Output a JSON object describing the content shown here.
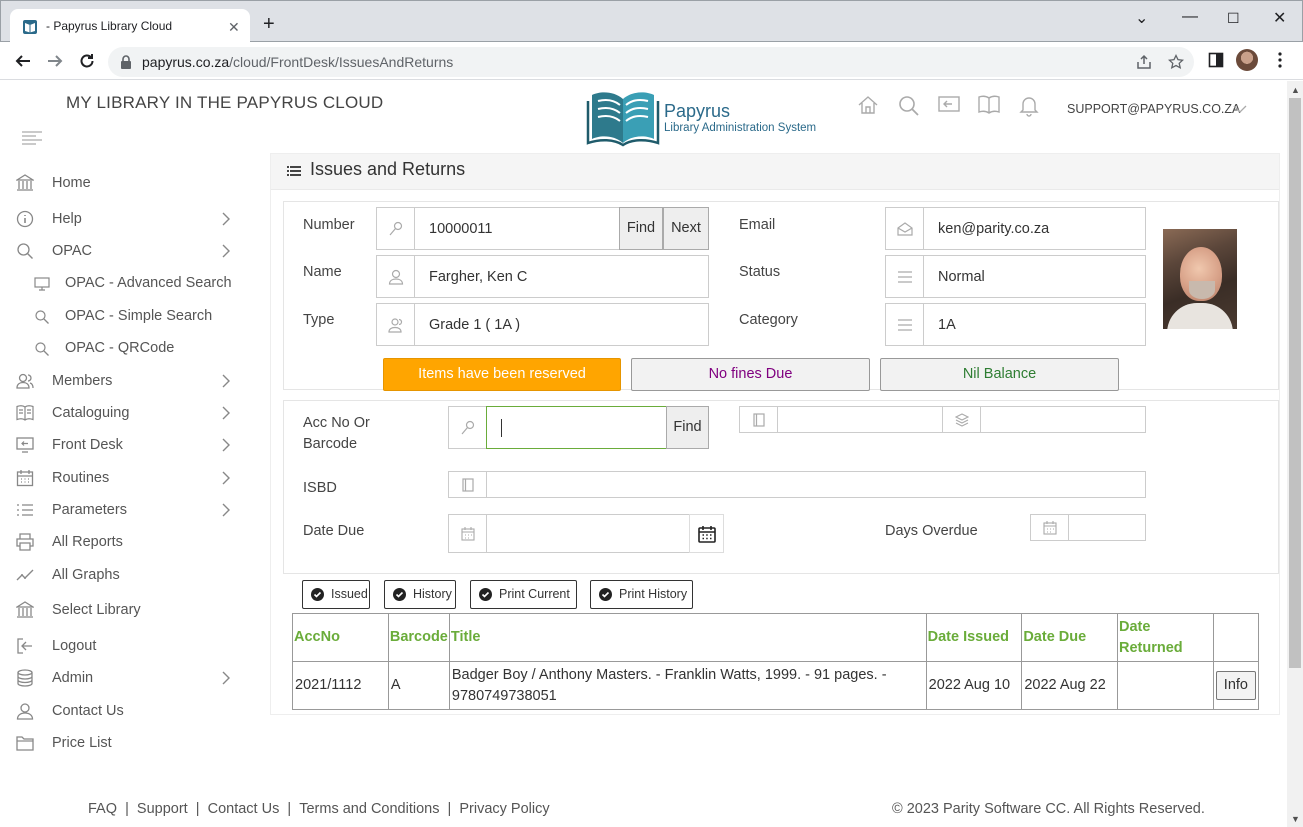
{
  "browser": {
    "tab_title": "- Papyrus Library Cloud",
    "url_host": "papyrus.co.za",
    "url_path": "/cloud/FrontDesk/IssuesAndReturns"
  },
  "header": {
    "brand": "MY LIBRARY IN THE PAPYRUS CLOUD",
    "logo_title": "Papyrus",
    "logo_subtitle": "Library Administration System",
    "user": "SUPPORT@PAPYRUS.CO.ZA"
  },
  "sidebar": {
    "items": [
      {
        "label": "Home",
        "icon": "bank-icon"
      },
      {
        "label": "Help",
        "icon": "info-icon"
      },
      {
        "label": "OPAC",
        "icon": "search-icon"
      },
      {
        "label": "OPAC - Advanced Search",
        "icon": "monitor-icon"
      },
      {
        "label": "OPAC - Simple Search",
        "icon": "search-icon"
      },
      {
        "label": "OPAC - QRCode",
        "icon": "search-icon"
      },
      {
        "label": "Members",
        "icon": "users-icon"
      },
      {
        "label": "Cataloguing",
        "icon": "book-icon"
      },
      {
        "label": "Front Desk",
        "icon": "desk-icon"
      },
      {
        "label": "Routines",
        "icon": "calendar-icon"
      },
      {
        "label": "Parameters",
        "icon": "list-icon"
      },
      {
        "label": "All Reports",
        "icon": "printer-icon"
      },
      {
        "label": "All Graphs",
        "icon": "chart-icon"
      },
      {
        "label": "Select Library",
        "icon": "bank-icon"
      },
      {
        "label": "Logout",
        "icon": "logout-icon"
      },
      {
        "label": "Admin",
        "icon": "database-icon"
      },
      {
        "label": "Contact Us",
        "icon": "user-icon"
      },
      {
        "label": "Price List",
        "icon": "folder-icon"
      }
    ]
  },
  "panel": {
    "title": "Issues and Returns"
  },
  "member": {
    "number_label": "Number",
    "number": "10000011",
    "find_label": "Find",
    "next_label": "Next",
    "name_label": "Name",
    "name": "Fargher, Ken C",
    "type_label": "Type",
    "type": "Grade 1 ( 1A )",
    "email_label": "Email",
    "email": "ken@parity.co.za",
    "status_label": "Status",
    "status": "Normal",
    "category_label": "Category",
    "category": "1A",
    "badges": {
      "reserved": "Items have been reserved",
      "fines": "No fines Due",
      "balance": "Nil Balance"
    },
    "colors": {
      "reserved_bg": "#ffa500",
      "fines_text": "#800080",
      "balance_text": "#2e7d32"
    }
  },
  "item": {
    "acc_label": "Acc No Or Barcode",
    "acc_value": "",
    "find_label": "Find",
    "isbd_label": "ISBD",
    "date_due_label": "Date Due",
    "days_overdue_label": "Days Overdue"
  },
  "actions": {
    "issued": "Issued",
    "history": "History",
    "print_current": "Print Current",
    "print_history": "Print History"
  },
  "table": {
    "headers": [
      "AccNo",
      "Barcode",
      "Title",
      "Date Issued",
      "Date Due",
      "Date Returned",
      ""
    ],
    "rows": [
      {
        "accno": "2021/1112",
        "barcode": "A",
        "title": "Badger Boy / Anthony Masters. - Franklin Watts, 1999. - 91 pages. - 9780749738051",
        "date_issued": "2022 Aug 10",
        "date_due": "2022 Aug 22",
        "date_returned": "",
        "action": "Info"
      }
    ]
  },
  "footer": {
    "links": [
      "FAQ",
      "Support",
      "Contact Us",
      "Terms and Conditions",
      "Privacy Policy"
    ],
    "copyright": "© 2023 Parity Software CC. All Rights Reserved."
  }
}
